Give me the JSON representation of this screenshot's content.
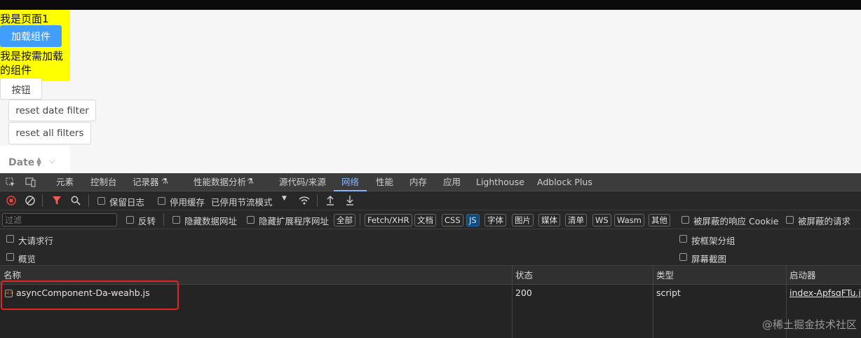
{
  "page": {
    "title_text": "我是页面1",
    "load_button": "加载组件",
    "async_text": "我是按需加载的组件",
    "button_label": "按钮",
    "reset_date_filter": "reset date filter",
    "reset_all_filters": "reset all filters",
    "date_header": "Date"
  },
  "devtools": {
    "tabs": [
      "元素",
      "控制台",
      "记录器",
      "性能数据分析",
      "源代码/来源",
      "网络",
      "性能",
      "内存",
      "应用",
      "Lighthouse",
      "Adblock Plus"
    ],
    "active_tab": "网络",
    "toolbar": {
      "preserve_log": "保留日志",
      "disable_cache": "停用缓存",
      "throttling": "已停用节流模式"
    },
    "filter": {
      "placeholder": "过滤",
      "invert": "反转",
      "hide_data_urls": "隐藏数据网址",
      "hide_extension_urls": "隐藏扩展程序网址",
      "types": [
        "全部",
        "Fetch/XHR",
        "文档",
        "CSS",
        "JS",
        "字体",
        "图片",
        "媒体",
        "清单",
        "WS",
        "Wasm",
        "其他"
      ],
      "active_type": "JS",
      "blocked_cookies": "被屏蔽的响应 Cookie",
      "blocked_requests": "被屏蔽的请求"
    },
    "options": {
      "big_request_rows": "大请求行",
      "overview": "概览",
      "group_by_frame": "按框架分组",
      "screenshots": "屏幕截图"
    },
    "table": {
      "headers": [
        "名称",
        "状态",
        "类型",
        "启动器"
      ],
      "rows": [
        {
          "name": "asyncComponent-Da-weahb.js",
          "status": "200",
          "type": "script",
          "initiator": "index-ApfsqFTu.js"
        }
      ]
    },
    "colors": {
      "active_tab": "#8ab4f8",
      "record_red": "#e8453c",
      "filter_icon": "#f25c54",
      "highlight_box": "#e5261f"
    }
  },
  "watermark": "@稀土掘金技术社区"
}
